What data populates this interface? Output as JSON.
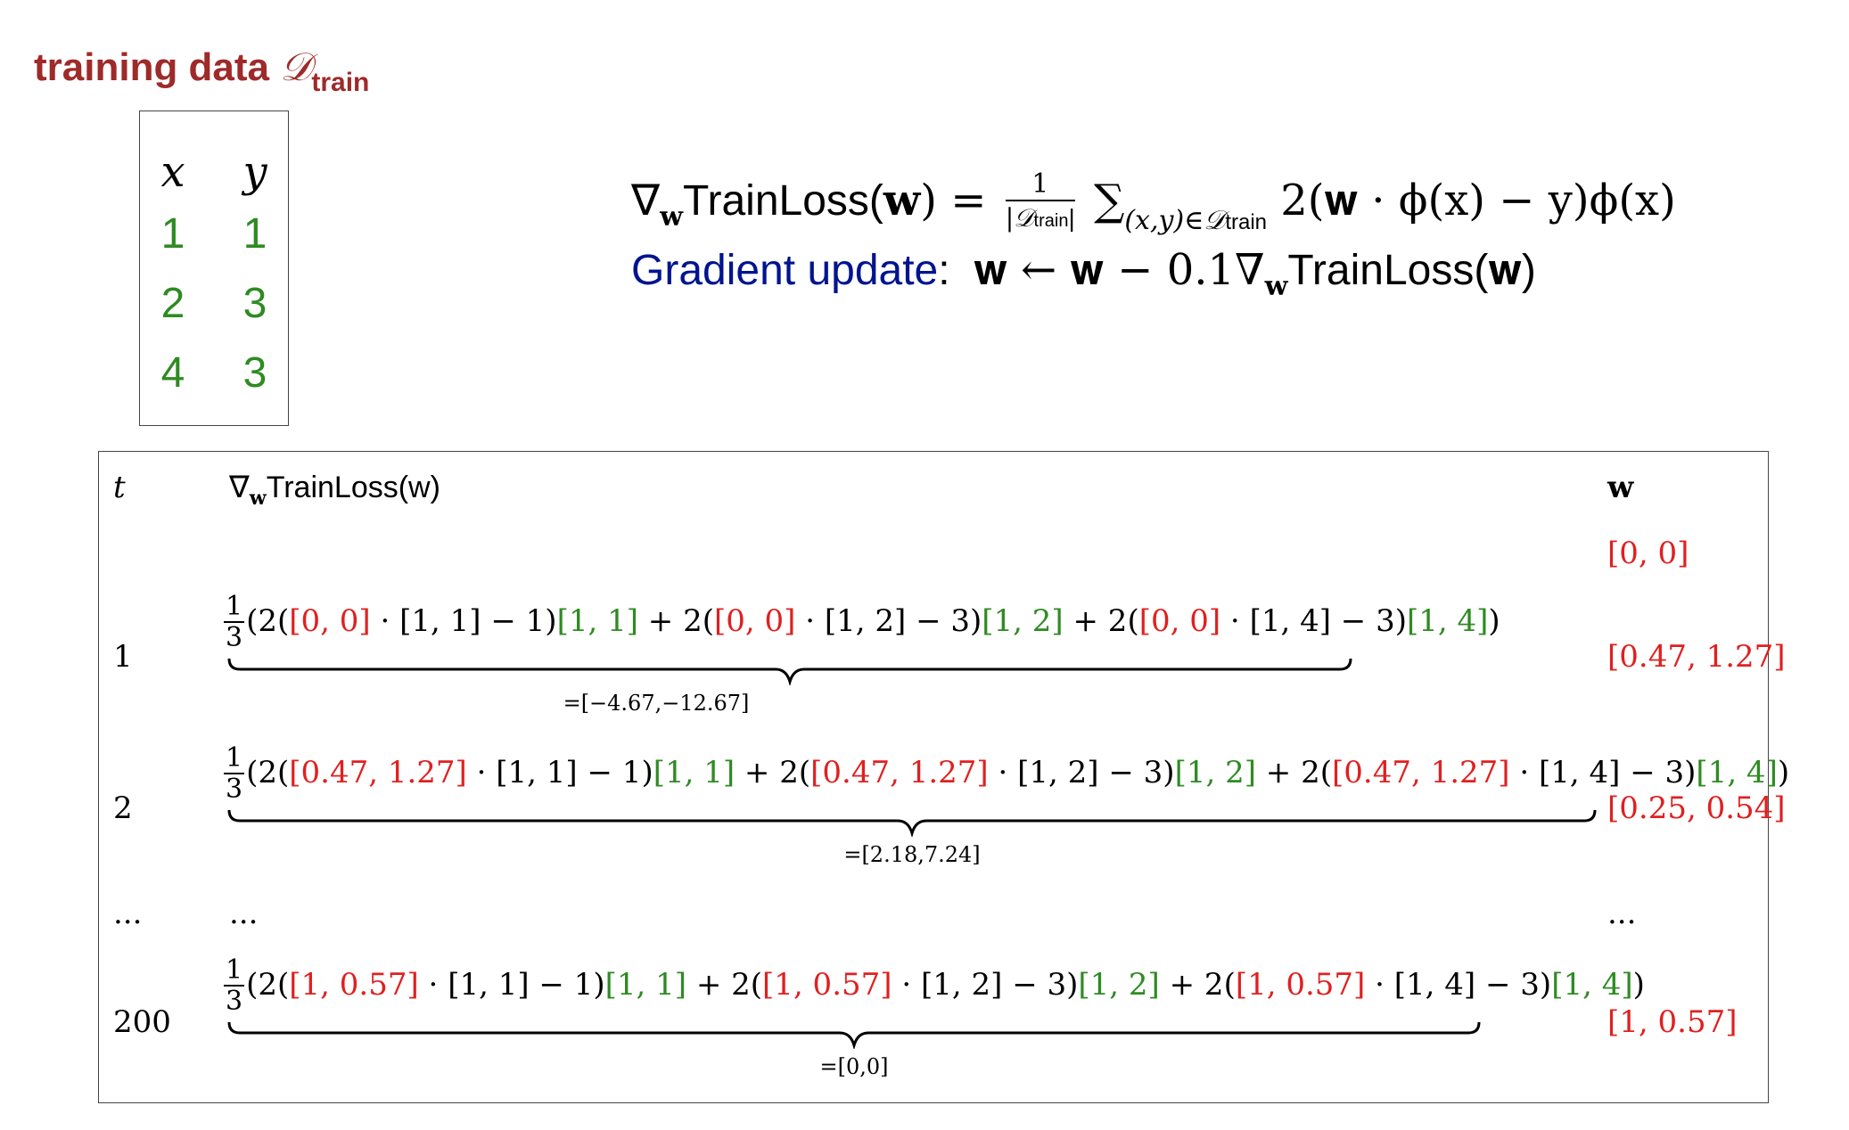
{
  "header": {
    "title_text": "training data ",
    "title_symbol": "𝒟",
    "title_sub": "train",
    "title_color": "#9e2a2a"
  },
  "data_table": {
    "headers": [
      "x",
      "y"
    ],
    "rows": [
      [
        "1",
        "1"
      ],
      [
        "2",
        "3"
      ],
      [
        "4",
        "3"
      ]
    ],
    "value_color": "#2e8b22"
  },
  "formula1": {
    "lhs": "∇",
    "lhs_sub": "w",
    "lhs_text": "TrainLoss(",
    "lhs_w": "w",
    "lhs_close": ") =",
    "frac_num": "1",
    "frac_den": "|𝒟",
    "frac_den_sub": "train",
    "frac_den_close": "|",
    "sum": "∑",
    "sum_sub": "(x,y)∈𝒟",
    "sum_sub2": "train",
    "rhs": " 2(𝐰 · ϕ(x) − y)ϕ(x)"
  },
  "formula2": {
    "label": "Gradient update",
    "colon": ":",
    "rhs": "𝐰 ← 𝐰 − 0.1∇",
    "rhs_sub": "w",
    "rhs_text": "TrainLoss(",
    "rhs_w": "𝐰",
    "rhs_close": ")",
    "label_color": "#00148f"
  },
  "iter_table": {
    "head_t": "t",
    "head_grad": "∇",
    "head_grad_sub": "w",
    "head_grad_text": "TrainLoss(w)",
    "head_w": "w",
    "initial_w": "[0, 0]",
    "frac_num": "1",
    "frac_den": "3",
    "rows": [
      {
        "t": "1",
        "w_prev": "[0, 0]",
        "result": "=[−4.67,−12.67]",
        "w": "[0.47, 1.27]"
      },
      {
        "t": "2",
        "w_prev": "[0.47, 1.27]",
        "result": "=[2.18,7.24]",
        "w": "[0.25, 0.54]"
      },
      {
        "t": "200",
        "w_prev": "[1, 0.57]",
        "result": "=[0,0]",
        "w": "[1, 0.57]"
      }
    ],
    "ellipsis": "...",
    "phi": [
      "[1, 1]",
      "[1, 2]",
      "[1, 4]"
    ],
    "ys": [
      "1",
      "3",
      "3"
    ],
    "red": "#e02020",
    "green": "#2e8b22"
  }
}
